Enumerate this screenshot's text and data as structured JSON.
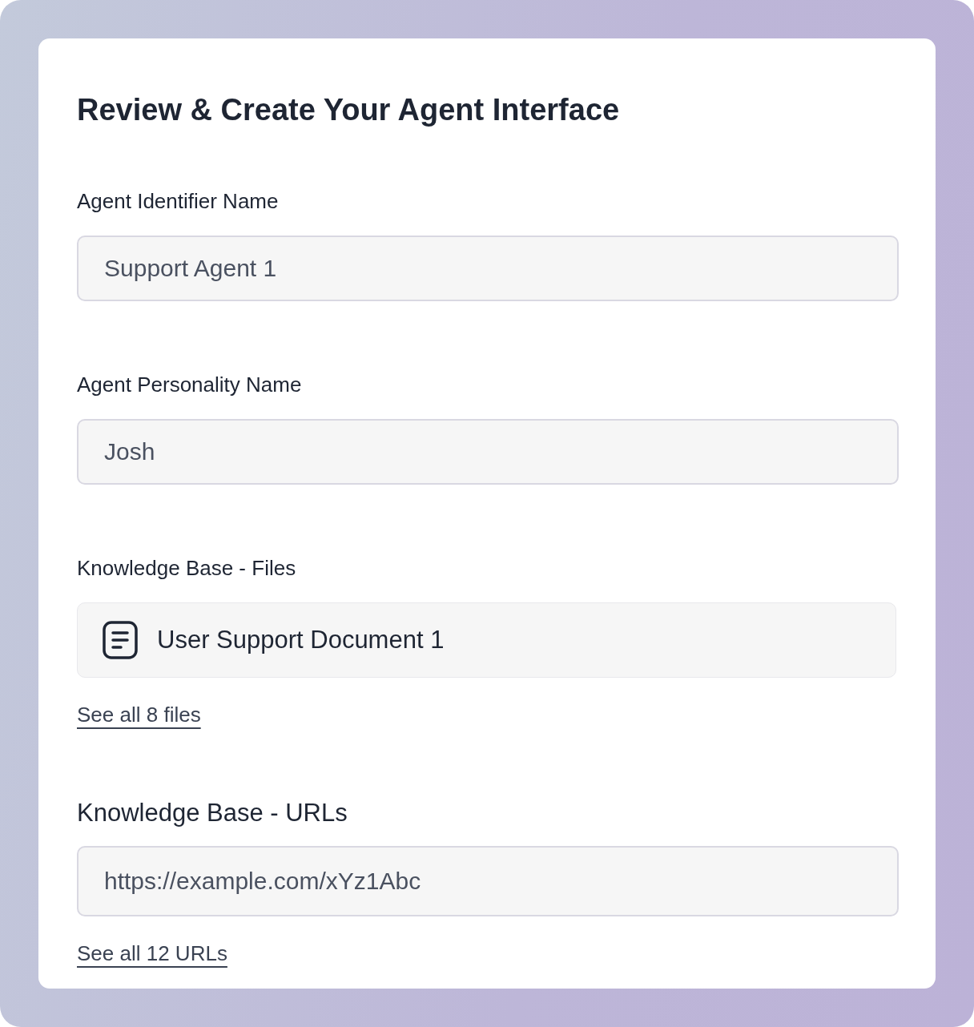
{
  "title": "Review & Create Your Agent Interface",
  "sections": [
    {
      "kind": "text",
      "label": "Agent Identifier Name",
      "value": "Support Agent 1"
    },
    {
      "kind": "text",
      "label": "Agent Personality Name",
      "value": "Josh"
    },
    {
      "kind": "files",
      "label": "Knowledge Base - Files",
      "files": [
        {
          "name": "User Support Document 1"
        }
      ],
      "link": "See all 8 files"
    },
    {
      "kind": "urls",
      "label": "Knowledge Base - URLs",
      "value": "https://example.com/xYz1Abc",
      "link": "See all 12 URLs"
    }
  ]
}
